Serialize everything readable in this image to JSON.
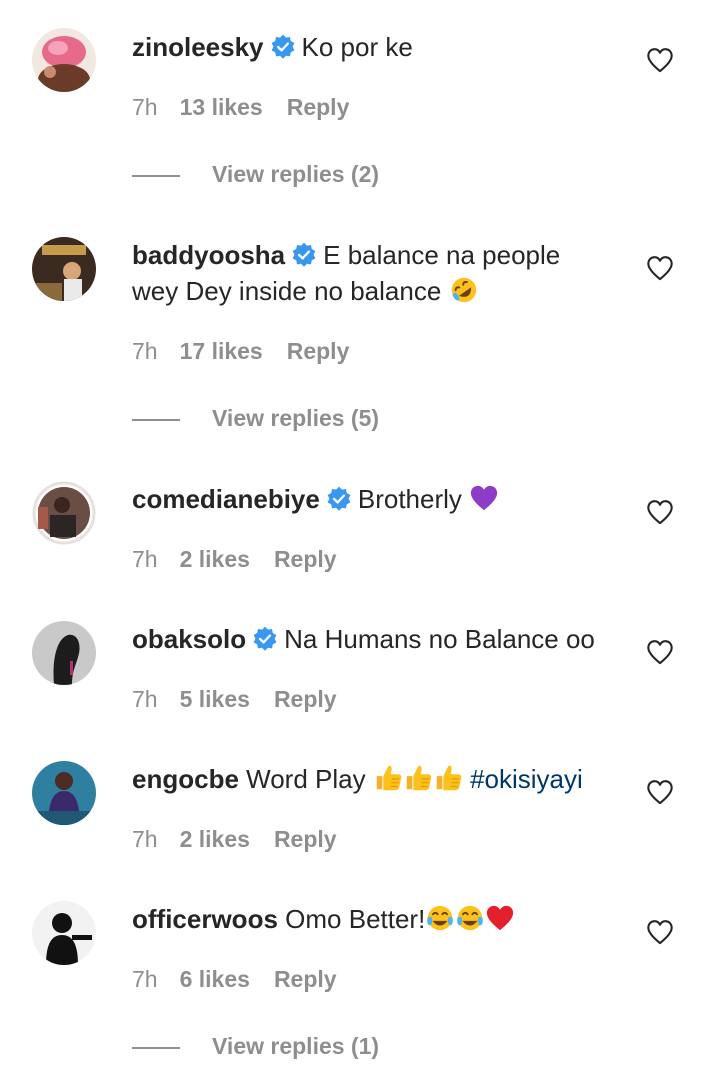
{
  "colors": {
    "text": "#262626",
    "muted": "#8e8e8e",
    "verified": "#3897f0",
    "hashtag": "#00376b",
    "heart_outline": "#262626"
  },
  "comments": [
    {
      "username": "zinoleesky",
      "verified": true,
      "text": "Ko por ke",
      "emoji": [],
      "time": "7h",
      "likes": "13 likes",
      "reply": "Reply",
      "view_replies": "View replies (2)"
    },
    {
      "username": "baddyoosha",
      "verified": true,
      "text": "E balance na people wey Dey inside no balance",
      "emoji": [
        "rofl-emoji"
      ],
      "time": "7h",
      "likes": "17 likes",
      "reply": "Reply",
      "view_replies": "View replies (5)"
    },
    {
      "username": "comedianebiye",
      "verified": true,
      "text": "Brotherly",
      "emoji": [
        "purple-heart-emoji"
      ],
      "time": "7h",
      "likes": "2 likes",
      "reply": "Reply"
    },
    {
      "username": "obaksolo",
      "verified": true,
      "text": "Na Humans no Balance oo",
      "emoji": [],
      "time": "7h",
      "likes": "5 likes",
      "reply": "Reply"
    },
    {
      "username": "engocbe",
      "verified": false,
      "text": "Word Play",
      "emoji": [
        "thumbs-up-emoji",
        "thumbs-up-emoji",
        "thumbs-up-emoji"
      ],
      "hashtag": "#okisiyayi",
      "time": "7h",
      "likes": "2 likes",
      "reply": "Reply"
    },
    {
      "username": "officerwoos",
      "verified": false,
      "text": "Omo Better!",
      "emoji": [
        "tears-of-joy-emoji",
        "tears-of-joy-emoji",
        "red-heart-emoji"
      ],
      "time": "7h",
      "likes": "6 likes",
      "reply": "Reply",
      "view_replies": "View replies (1)"
    }
  ]
}
